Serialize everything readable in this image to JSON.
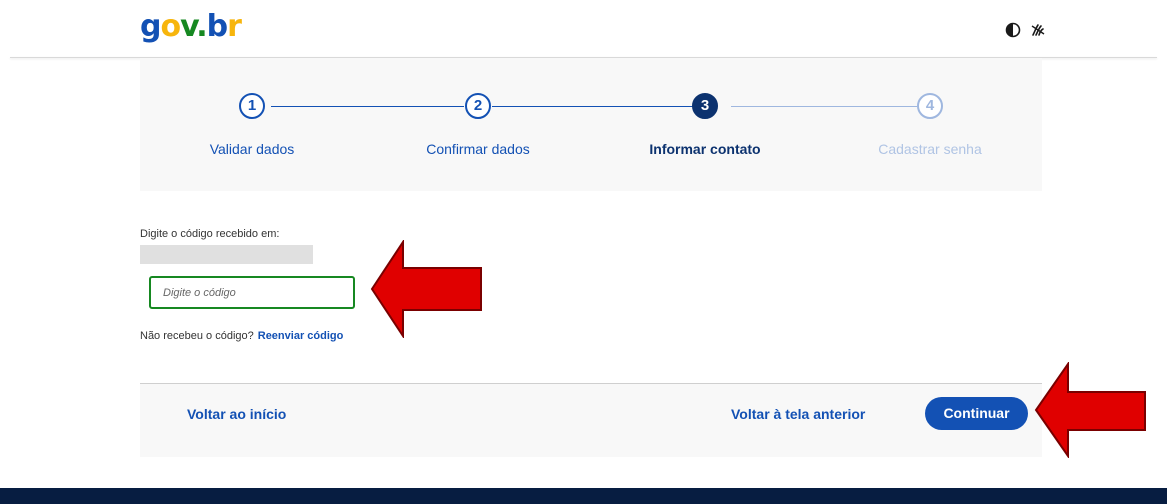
{
  "header": {
    "logo_parts": [
      "g",
      "o",
      "v",
      ".",
      "b",
      "r"
    ],
    "contrast_icon": "contrast-icon",
    "libras_icon": "sign-language-icon"
  },
  "stepper": {
    "steps": [
      {
        "number": "1",
        "label": "Validar dados",
        "state": "done"
      },
      {
        "number": "2",
        "label": "Confirmar dados",
        "state": "done"
      },
      {
        "number": "3",
        "label": "Informar contato",
        "state": "current"
      },
      {
        "number": "4",
        "label": "Cadastrar senha",
        "state": "future"
      }
    ]
  },
  "form": {
    "prompt": "Digite o código recebido em:",
    "code_placeholder": "Digite o código",
    "code_value": "",
    "resend_question": "Não recebeu o código?",
    "resend_link": "Reenviar código"
  },
  "actions": {
    "back_to_start": "Voltar ao início",
    "back_previous": "Voltar à tela anterior",
    "continue": "Continuar"
  },
  "colors": {
    "primary": "#1351b4",
    "primary_dark": "#0c326f",
    "success_border": "#168821",
    "annotation_arrow": "#e00000",
    "footer": "#071d41"
  }
}
